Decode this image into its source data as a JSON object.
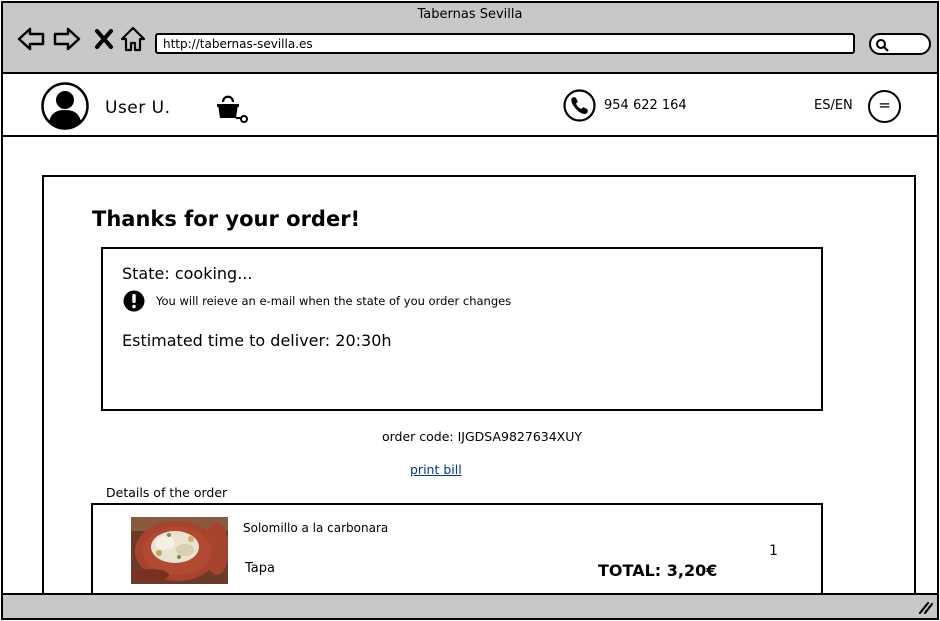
{
  "browser": {
    "title": "Tabernas Sevilla",
    "url": "http://tabernas-sevilla.es",
    "icons": [
      "back-arrow-icon",
      "forward-arrow-icon",
      "close-x-icon",
      "home-icon",
      "search-icon"
    ]
  },
  "header": {
    "user_name": "User U.",
    "phone": "954 622 164",
    "language": "ES/EN",
    "menu_glyph": "="
  },
  "order": {
    "title": "Thanks for your order!",
    "state": "State: cooking...",
    "notice": "You will reieve an e-mail when the state of you order changes",
    "eta": "Estimated time to deliver: 20:30h",
    "code": "order code: IJGDSA9827634XUY",
    "print_label": "print bill",
    "details_label": "Details of the order",
    "items": [
      {
        "name": "Solomillo a la carbonara",
        "type": "Tapa",
        "quantity": "1",
        "total": "TOTAL: 3,20€"
      }
    ]
  }
}
